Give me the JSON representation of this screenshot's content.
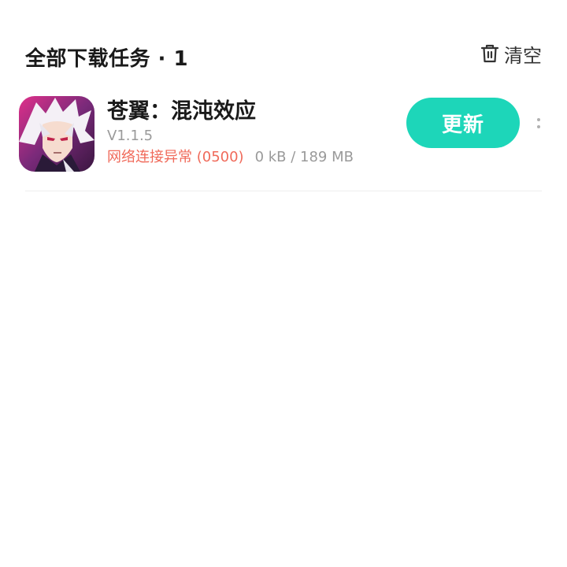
{
  "header": {
    "title": "全部下载任务 · 1",
    "clear_label": "清空",
    "clear_icon": "trash-icon"
  },
  "task": {
    "name": "苍翼：混沌效应",
    "version": "V1.1.5",
    "status_error": "网络连接异常 (0500)",
    "size_progress": "0 kB / 189 MB",
    "action_label": "更新",
    "more_icon": "more-vertical-icon"
  },
  "colors": {
    "accent": "#1dd6b9",
    "error": "#f06a5a",
    "muted": "#9a9a9a"
  }
}
